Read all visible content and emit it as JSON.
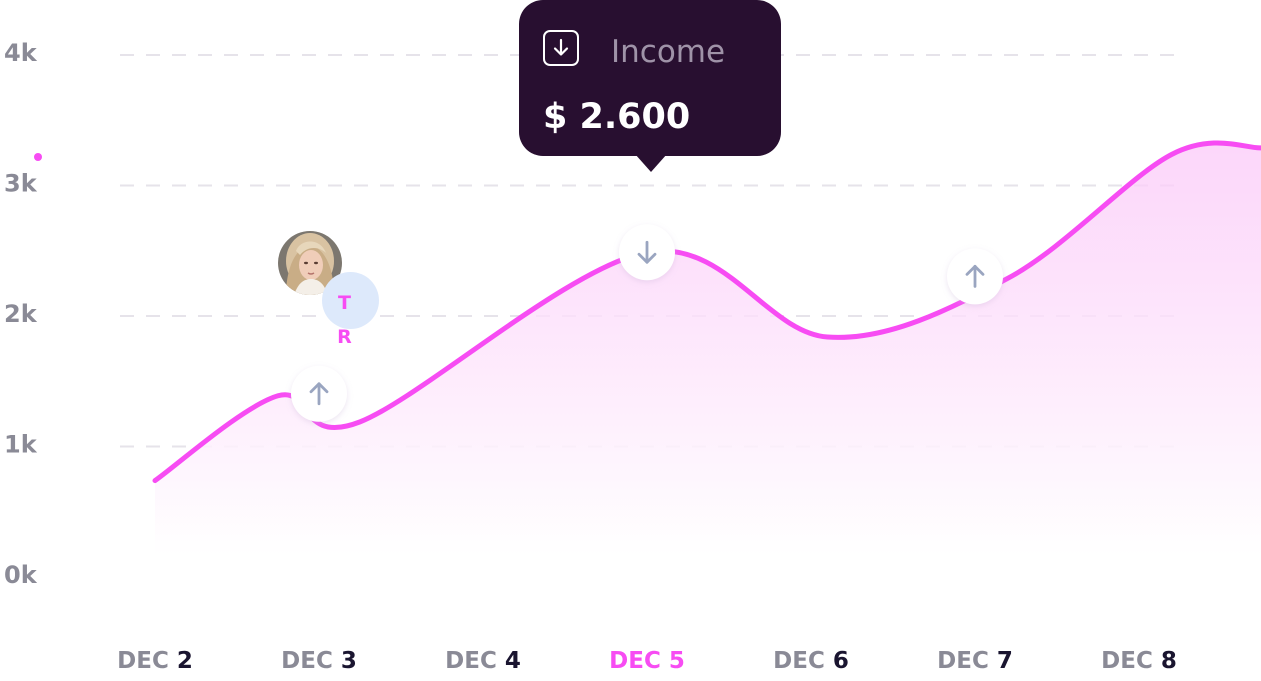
{
  "chart_data": {
    "type": "area",
    "categories": [
      "DEC 2",
      "DEC 3",
      "DEC 4",
      "DEC 5",
      "DEC 6",
      "DEC 7",
      "DEC 8"
    ],
    "x_labels": [
      {
        "prefix": "DEC",
        "number": "2"
      },
      {
        "prefix": "DEC",
        "number": "3"
      },
      {
        "prefix": "DEC",
        "number": "4"
      },
      {
        "prefix": "DEC",
        "number": "5",
        "active": true
      },
      {
        "prefix": "DEC",
        "number": "6"
      },
      {
        "prefix": "DEC",
        "number": "7"
      },
      {
        "prefix": "DEC",
        "number": "8"
      }
    ],
    "series": [
      {
        "values": [
          0.8,
          1.45,
          1.25,
          2.55,
          1.9,
          2.35,
          3.3,
          3.35
        ],
        "x": [
          2,
          2.75,
          3.25,
          5,
          6.1,
          7.2,
          8.2,
          8.8
        ]
      }
    ],
    "markers": [
      {
        "x": 3,
        "y": 1.45,
        "direction": "up"
      },
      {
        "x": 5,
        "y": 2.55,
        "direction": "down"
      },
      {
        "x": 7,
        "y": 2.35,
        "direction": "up"
      }
    ],
    "yticks": [
      "0k",
      "1k",
      "2k",
      "3k",
      "4k"
    ],
    "ylim": [
      0,
      4
    ],
    "grid": true,
    "line_color": "#f74cf3",
    "marker_arrow_color": "#9aa5c0"
  },
  "tooltip": {
    "label": "Income",
    "value": "$ 2.600",
    "icon": "download-icon",
    "background": "#280f30"
  },
  "avatars": {
    "photo": "user-photo-avatar",
    "initials": [
      "T",
      "R"
    ],
    "initials_bg": "#dde9fb"
  }
}
